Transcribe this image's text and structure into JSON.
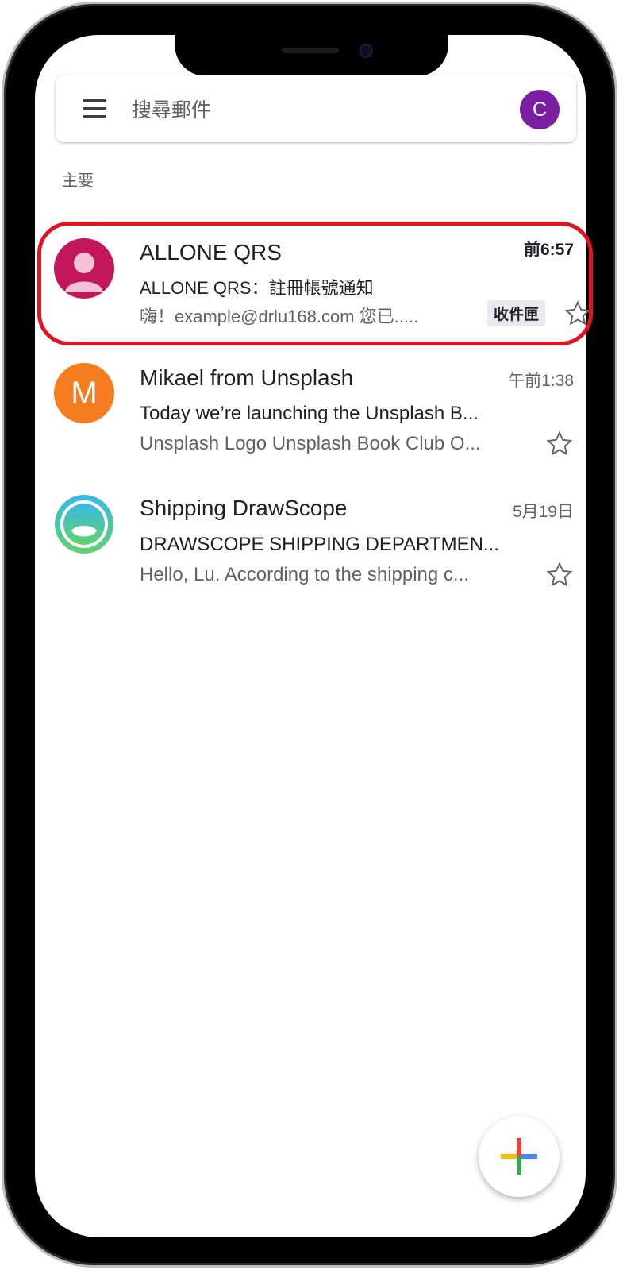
{
  "search": {
    "placeholder": "搜尋郵件",
    "avatar_letter": "C"
  },
  "section": {
    "label": "主要"
  },
  "emails": [
    {
      "sender": "ALLONE QRS",
      "subject": "ALLONE QRS：註冊帳號通知",
      "snippet": "嗨！example@drlu168.com 您已.....",
      "time": "前6:57",
      "label": "收件匣",
      "avatar_color": "#c2185b"
    },
    {
      "sender": "Mikael from Unsplash",
      "subject": "Today we’re launching the Unsplash B...",
      "snippet": "Unsplash Logo Unsplash Book Club O...",
      "time": "午前1:38",
      "avatar_letter": "M",
      "avatar_color": "#f57c1f"
    },
    {
      "sender": "Shipping DrawScope",
      "subject": "DRAWSCOPE SHIPPING DEPARTMEN...",
      "snippet": "Hello, Lu. According to the shipping c...",
      "time": "5月19日",
      "avatar_color": "#3ec97a"
    }
  ],
  "colors": {
    "highlight": "#e0141e",
    "accent_purple": "#7b1fa2"
  },
  "icons": [
    "menu-icon",
    "star-icon",
    "compose-plus-icon"
  ]
}
